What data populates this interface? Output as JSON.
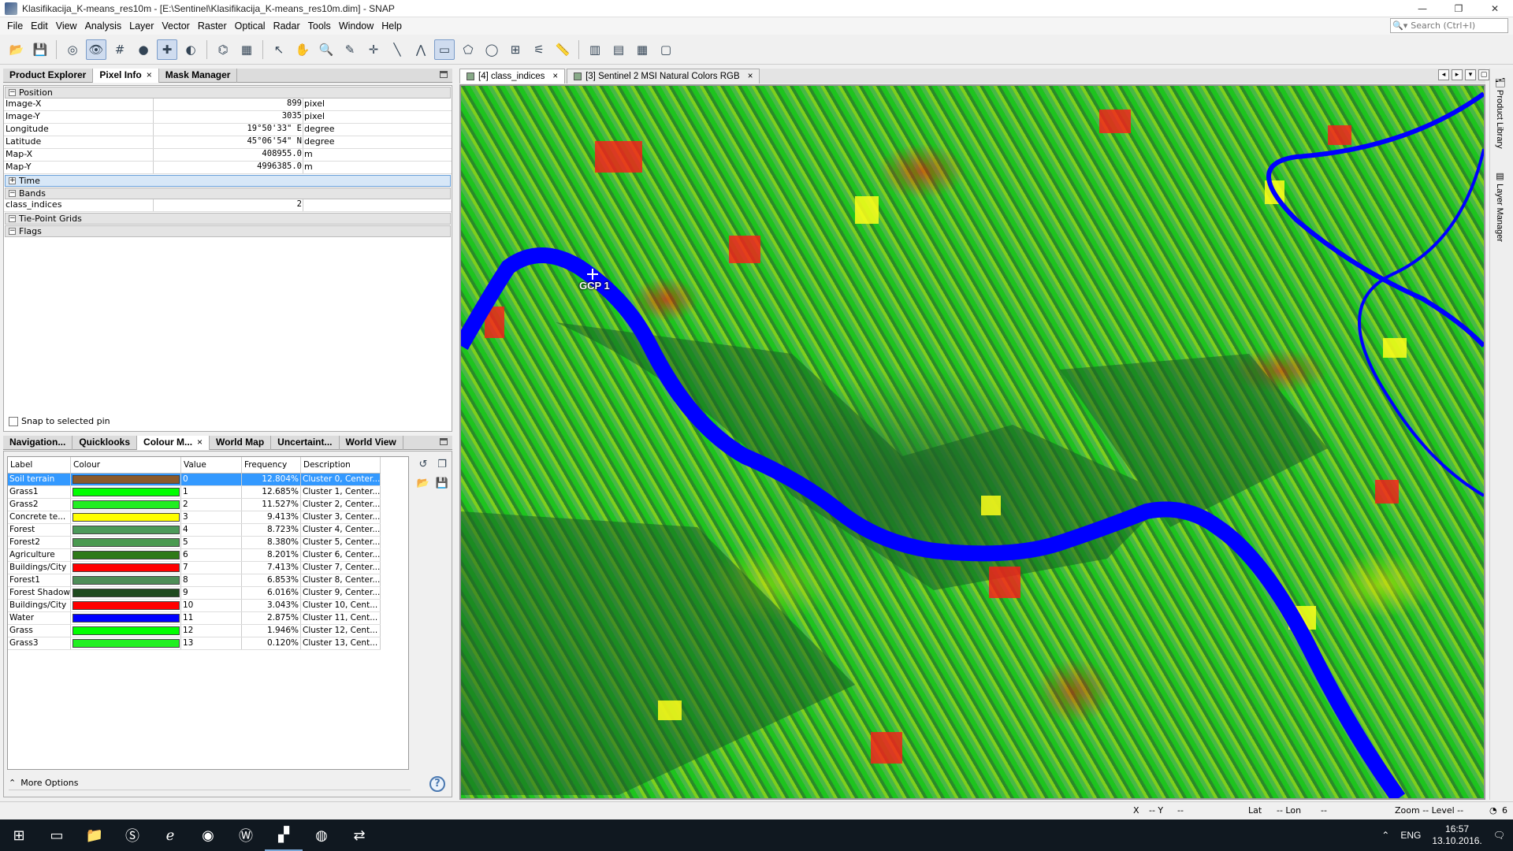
{
  "window": {
    "title": "Klasifikacija_K-means_res10m - [E:\\Sentinel\\Klasifikacija_K-means_res10m.dim] - SNAP",
    "minimize": "—",
    "restore": "❐",
    "close": "✕"
  },
  "menu": [
    "File",
    "Edit",
    "View",
    "Analysis",
    "Layer",
    "Vector",
    "Raster",
    "Optical",
    "Radar",
    "Tools",
    "Window",
    "Help"
  ],
  "search": {
    "placeholder": "Search (Ctrl+I)"
  },
  "toolbar_icons": [
    "open-product-icon",
    "save-product-icon",
    "session-icon",
    "view-icon",
    "grid-icon",
    "pin-icon",
    "gcp-icon",
    "mask-icon",
    "graph-builder-icon",
    "batch-icon",
    "select-tool-icon",
    "pan-tool-icon",
    "zoom-tool-icon",
    "pin-placing-icon",
    "gcp-placing-icon",
    "line-draw-icon",
    "polyline-draw-icon",
    "rectangle-draw-icon",
    "polygon-draw-icon",
    "ellipse-draw-icon",
    "range-finder-icon",
    "magic-wand-icon",
    "ruler-icon",
    "tile-horizontal-icon",
    "tile-vertical-icon",
    "tile-grid-icon",
    "tile-single-icon"
  ],
  "left_top_tabs": {
    "tab1": "Product Explorer",
    "tab2": "Pixel Info",
    "tab3": "Mask Manager"
  },
  "pixel_info": {
    "position_header": "Position",
    "rows": [
      {
        "k": "Image-X",
        "v": "899",
        "u": "pixel"
      },
      {
        "k": "Image-Y",
        "v": "3035",
        "u": "pixel"
      },
      {
        "k": "Longitude",
        "v": "19°50'33\" E",
        "u": "degree"
      },
      {
        "k": "Latitude",
        "v": "45°06'54\" N",
        "u": "degree"
      },
      {
        "k": "Map-X",
        "v": "408955.0",
        "u": "m"
      },
      {
        "k": "Map-Y",
        "v": "4996385.0",
        "u": "m"
      }
    ],
    "time_header": "Time",
    "bands_header": "Bands",
    "band_row": {
      "k": "class_indices",
      "v": "2"
    },
    "tiepoint_header": "Tie-Point Grids",
    "flags_header": "Flags",
    "snap_label": "Snap to selected pin"
  },
  "left_bottom_tabs": {
    "tab1": "Navigation...",
    "tab2": "Quicklooks",
    "tab3": "Colour M...",
    "tab4": "World Map",
    "tab5": "Uncertaint...",
    "tab6": "World View"
  },
  "colour_table": {
    "headers": {
      "label": "Label",
      "colour": "Colour",
      "value": "Value",
      "frequency": "Frequency",
      "description": "Description"
    },
    "rows": [
      {
        "label": "Soil terrain",
        "color": "#8b5a2b",
        "value": "0",
        "frequency": "12.804%",
        "description": "Cluster 0, Center..."
      },
      {
        "label": "Grass1",
        "color": "#00ff00",
        "value": "1",
        "frequency": "12.685%",
        "description": "Cluster 1, Center..."
      },
      {
        "label": "Grass2",
        "color": "#22ee22",
        "value": "2",
        "frequency": "11.527%",
        "description": "Cluster 2, Center..."
      },
      {
        "label": "Concrete te...",
        "color": "#ffff00",
        "value": "3",
        "frequency": "9.413%",
        "description": "Cluster 3, Center..."
      },
      {
        "label": "Forest",
        "color": "#4c9a5a",
        "value": "4",
        "frequency": "8.723%",
        "description": "Cluster 4, Center..."
      },
      {
        "label": "Forest2",
        "color": "#4a9a50",
        "value": "5",
        "frequency": "8.380%",
        "description": "Cluster 5, Center..."
      },
      {
        "label": "Agriculture",
        "color": "#2e7a18",
        "value": "6",
        "frequency": "8.201%",
        "description": "Cluster 6, Center..."
      },
      {
        "label": "Buildings/City",
        "color": "#ff0000",
        "value": "7",
        "frequency": "7.413%",
        "description": "Cluster 7, Center..."
      },
      {
        "label": "Forest1",
        "color": "#4e8e58",
        "value": "8",
        "frequency": "6.853%",
        "description": "Cluster 8, Center..."
      },
      {
        "label": "Forest Shadow",
        "color": "#1e4a1e",
        "value": "9",
        "frequency": "6.016%",
        "description": "Cluster 9, Center..."
      },
      {
        "label": "Buildings/City",
        "color": "#ff0000",
        "value": "10",
        "frequency": "3.043%",
        "description": "Cluster 10, Cent..."
      },
      {
        "label": "Water",
        "color": "#0000ff",
        "value": "11",
        "frequency": "2.875%",
        "description": "Cluster 11, Cent..."
      },
      {
        "label": "Grass",
        "color": "#00ff00",
        "value": "12",
        "frequency": "1.946%",
        "description": "Cluster 12, Cent..."
      },
      {
        "label": "Grass3",
        "color": "#22f022",
        "value": "13",
        "frequency": "0.120%",
        "description": "Cluster 13, Cent..."
      }
    ],
    "more_options": "More Options"
  },
  "doc_tabs": {
    "tab1": "[4] class_indices",
    "tab2": "[3] Sentinel 2 MSI Natural Colors RGB"
  },
  "image": {
    "gcp_label": "GCP 1"
  },
  "right_strip": {
    "tab1": "Product Library",
    "tab2": "Layer Manager"
  },
  "status": {
    "x": "X",
    "x_val": "-- Y",
    "y_val": "--",
    "lat": "Lat",
    "lat_val": "-- Lon",
    "lon_val": "--",
    "zoom": "Zoom -- Level --",
    "count": "6"
  },
  "taskbar": {
    "lang": "ENG",
    "time": "16:57",
    "date": "13.10.2016."
  }
}
